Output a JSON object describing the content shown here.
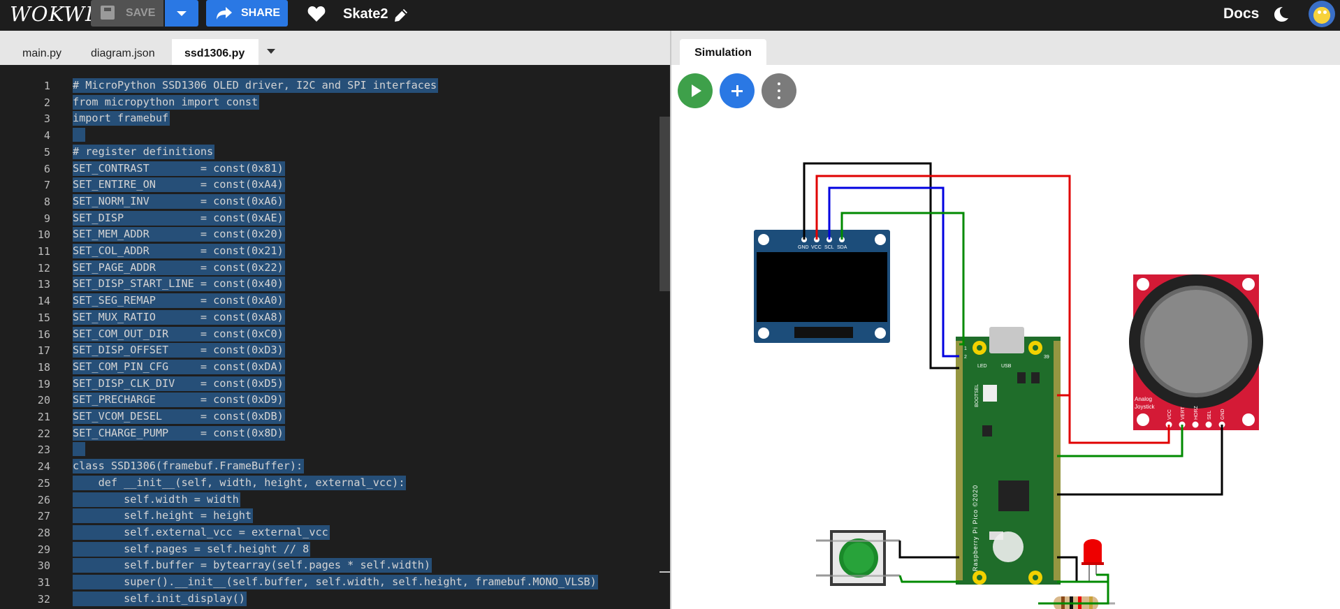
{
  "app": {
    "logo": "WOKWI",
    "save_label": "SAVE",
    "share_label": "SHARE",
    "project_name": "Skate2",
    "docs_label": "Docs"
  },
  "editor": {
    "tabs": [
      "main.py",
      "diagram.json",
      "ssd1306.py"
    ],
    "active_tab": "ssd1306.py",
    "lines": [
      {
        "n": "1",
        "code": "# MicroPython SSD1306 OLED driver, I2C and SPI interfaces"
      },
      {
        "n": "2",
        "code": "from micropython import const"
      },
      {
        "n": "3",
        "code": "import framebuf"
      },
      {
        "n": "4",
        "code": ""
      },
      {
        "n": "5",
        "code": "# register definitions"
      },
      {
        "n": "6",
        "code": "SET_CONTRAST        = const(0x81)"
      },
      {
        "n": "7",
        "code": "SET_ENTIRE_ON       = const(0xA4)"
      },
      {
        "n": "8",
        "code": "SET_NORM_INV        = const(0xA6)"
      },
      {
        "n": "9",
        "code": "SET_DISP            = const(0xAE)"
      },
      {
        "n": "10",
        "code": "SET_MEM_ADDR        = const(0x20)"
      },
      {
        "n": "11",
        "code": "SET_COL_ADDR        = const(0x21)"
      },
      {
        "n": "12",
        "code": "SET_PAGE_ADDR       = const(0x22)"
      },
      {
        "n": "13",
        "code": "SET_DISP_START_LINE = const(0x40)"
      },
      {
        "n": "14",
        "code": "SET_SEG_REMAP       = const(0xA0)"
      },
      {
        "n": "15",
        "code": "SET_MUX_RATIO       = const(0xA8)"
      },
      {
        "n": "16",
        "code": "SET_COM_OUT_DIR     = const(0xC0)"
      },
      {
        "n": "17",
        "code": "SET_DISP_OFFSET     = const(0xD3)"
      },
      {
        "n": "18",
        "code": "SET_COM_PIN_CFG     = const(0xDA)"
      },
      {
        "n": "19",
        "code": "SET_DISP_CLK_DIV    = const(0xD5)"
      },
      {
        "n": "20",
        "code": "SET_PRECHARGE       = const(0xD9)"
      },
      {
        "n": "21",
        "code": "SET_VCOM_DESEL      = const(0xDB)"
      },
      {
        "n": "22",
        "code": "SET_CHARGE_PUMP     = const(0x8D)"
      },
      {
        "n": "23",
        "code": ""
      },
      {
        "n": "24",
        "code": "class SSD1306(framebuf.FrameBuffer):"
      },
      {
        "n": "25",
        "code": "    def __init__(self, width, height, external_vcc):"
      },
      {
        "n": "26",
        "code": "        self.width = width"
      },
      {
        "n": "27",
        "code": "        self.height = height"
      },
      {
        "n": "28",
        "code": "        self.external_vcc = external_vcc"
      },
      {
        "n": "29",
        "code": "        self.pages = self.height // 8"
      },
      {
        "n": "30",
        "code": "        self.buffer = bytearray(self.pages * self.width)"
      },
      {
        "n": "31",
        "code": "        super().__init__(self.buffer, self.width, self.height, framebuf.MONO_VLSB)"
      },
      {
        "n": "32",
        "code": "        self.init_display()"
      }
    ]
  },
  "simulation": {
    "tab_label": "Simulation",
    "oled_pins": [
      "GND",
      "VCC",
      "SCL",
      "SDA"
    ],
    "joystick_label": [
      "Analog",
      "Joystick"
    ],
    "joystick_pins": [
      "VCC",
      "VERT",
      "HORZ",
      "SEL",
      "GND"
    ],
    "pico_label": "Raspberry Pi Pico ©2020",
    "pico_text": {
      "led": "LED",
      "usb": "USB",
      "bootsel": "BOOTSEL",
      "pin1": "1",
      "pin2": "2",
      "pin39": "39"
    }
  },
  "colors": {
    "accent_blue": "#2a78e4",
    "play_green": "#3ea04a",
    "wire_red": "#e00000",
    "wire_green": "#008a00",
    "wire_blue": "#0000e0",
    "wire_black": "#000000",
    "selection": "#264f78"
  }
}
